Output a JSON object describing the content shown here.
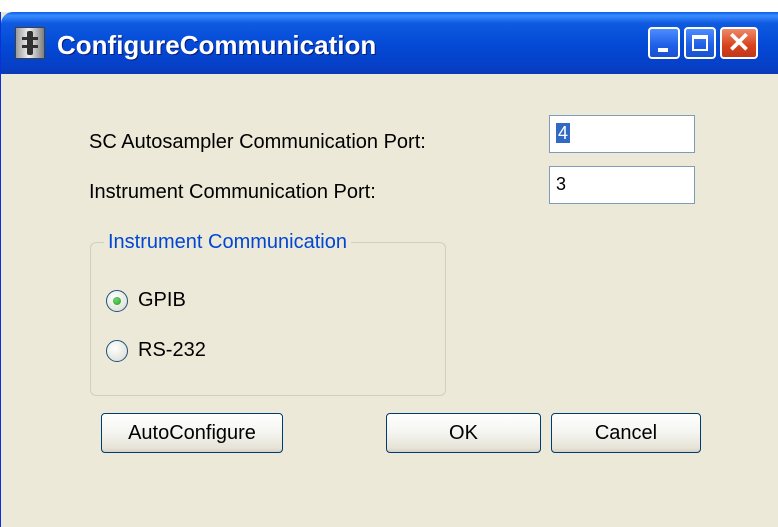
{
  "window": {
    "title": "ConfigureCommunication",
    "controls": {
      "minimize": "minimize",
      "maximize": "maximize",
      "close": "✕"
    }
  },
  "fields": {
    "sc_port_label": "SC Autosampler Communication Port:",
    "sc_port_value": "4",
    "instrument_port_label": "Instrument Communication Port:",
    "instrument_port_value": "3"
  },
  "group": {
    "legend": "Instrument Communication",
    "options": [
      {
        "label": "GPIB",
        "selected": true
      },
      {
        "label": "RS-232",
        "selected": false
      }
    ]
  },
  "buttons": {
    "autoconfigure": "AutoConfigure",
    "ok": "OK",
    "cancel": "Cancel"
  },
  "colors": {
    "titlebar": "#0349d6",
    "window_bg": "#ece9d8",
    "group_legend": "#0046d5",
    "radio_selected": "#21a121"
  },
  "icons": [
    "app-icon",
    "minimize-icon",
    "maximize-icon",
    "close-icon"
  ]
}
